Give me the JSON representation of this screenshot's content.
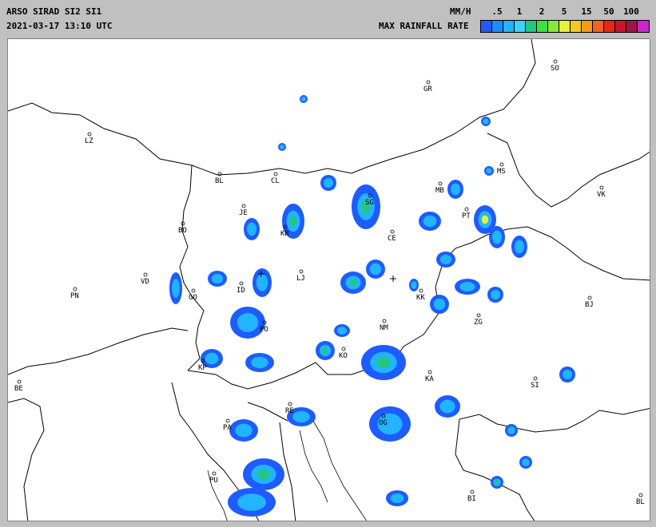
{
  "header": {
    "line1": "ARSO SIRAD SI2 SI1",
    "line2": "2021-03-17 13:10 UTC"
  },
  "legend": {
    "units": "MM/H",
    "caption": "MAX RAINFALL RATE",
    "ticks": [
      ".5",
      "1",
      "2",
      "5",
      "15",
      "50",
      "100"
    ],
    "colors": [
      "#1e5cff",
      "#1f8cff",
      "#22b4ff",
      "#3cd2ff",
      "#22c87a",
      "#3fe03f",
      "#8ae63a",
      "#e6f03a",
      "#f5c81e",
      "#f59a1e",
      "#f0641e",
      "#e62814",
      "#c8142d",
      "#a01446",
      "#c828c8"
    ]
  },
  "map": {
    "cities": [
      {
        "code": "SO"
      },
      {
        "code": "GR"
      },
      {
        "code": "LZ"
      },
      {
        "code": "BL"
      },
      {
        "code": "CL"
      },
      {
        "code": "MS"
      },
      {
        "code": "MB"
      },
      {
        "code": "VK"
      },
      {
        "code": "SG"
      },
      {
        "code": "JE"
      },
      {
        "code": "PT"
      },
      {
        "code": "BO"
      },
      {
        "code": "KR"
      },
      {
        "code": "CE"
      },
      {
        "code": "VD"
      },
      {
        "code": "LJ"
      },
      {
        "code": "PN"
      },
      {
        "code": "GO"
      },
      {
        "code": "ID"
      },
      {
        "code": "KK"
      },
      {
        "code": "BJ"
      },
      {
        "code": "ZG"
      },
      {
        "code": "NM"
      },
      {
        "code": "PO"
      },
      {
        "code": "KO"
      },
      {
        "code": "KP"
      },
      {
        "code": "KA"
      },
      {
        "code": "SI"
      },
      {
        "code": "BE"
      },
      {
        "code": "RE"
      },
      {
        "code": "PA"
      },
      {
        "code": "OG"
      },
      {
        "code": "PU"
      },
      {
        "code": "BI"
      },
      {
        "code": "BL"
      }
    ]
  }
}
